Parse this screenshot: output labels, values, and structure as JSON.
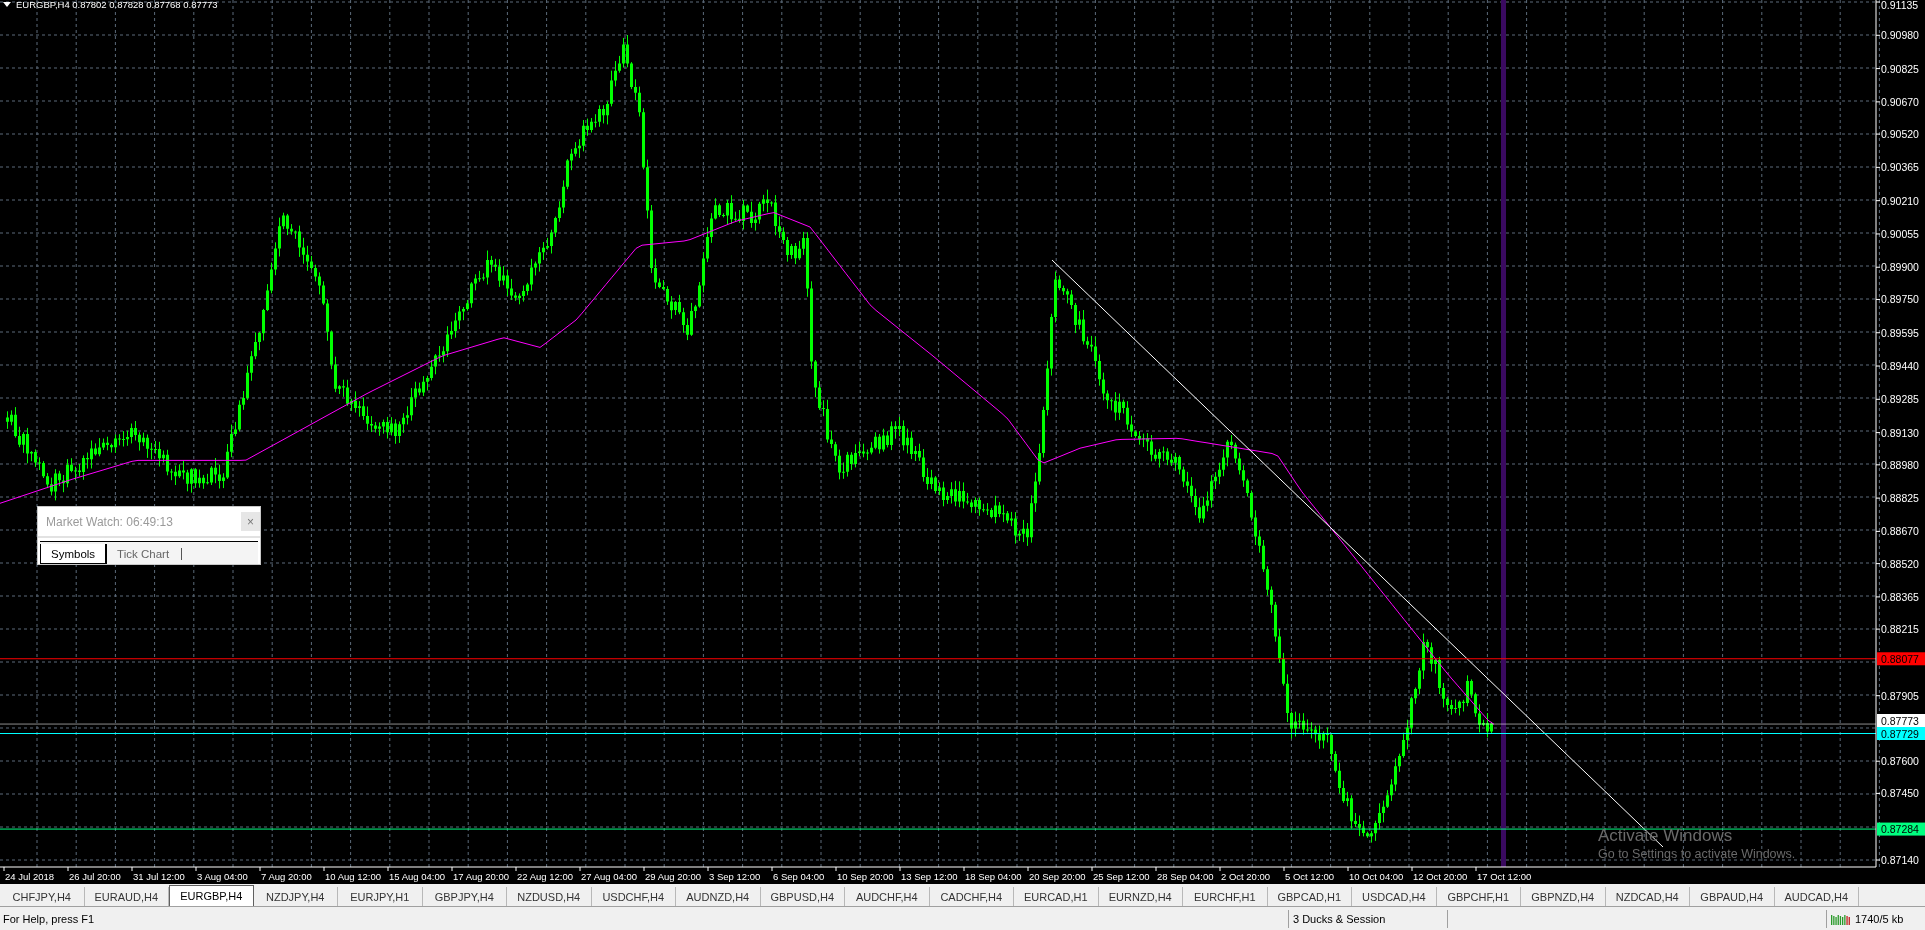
{
  "chart": {
    "title": "EURGBP,H4  0.87802 0.87828 0.87768 0.87773",
    "price_axis": [
      "0.91135",
      "0.90980",
      "0.90825",
      "0.90670",
      "0.90520",
      "0.90365",
      "0.90210",
      "0.90055",
      "0.89900",
      "0.89750",
      "0.89595",
      "0.89440",
      "0.89285",
      "0.89130",
      "0.88980",
      "0.88825",
      "0.88670",
      "0.88520",
      "0.88365",
      "0.88215",
      "0.87905",
      "0.87600",
      "0.87450",
      "0.87140"
    ],
    "levels": [
      {
        "label": "0.88077",
        "color": "#ff0000"
      },
      {
        "label": "0.87773",
        "color": "#ffffff"
      },
      {
        "label": "0.87729",
        "color": "#00ffff"
      },
      {
        "label": "0.87284",
        "color": "#00ff80"
      }
    ],
    "time_axis": [
      "24 Jul 2018",
      "26 Jul 20:00",
      "31 Jul 12:00",
      "3 Aug 04:00",
      "7 Aug 20:00",
      "10 Aug 12:00",
      "15 Aug 04:00",
      "17 Aug 20:00",
      "22 Aug 12:00",
      "27 Aug 04:00",
      "29 Aug 20:00",
      "3 Sep 12:00",
      "6 Sep 04:00",
      "10 Sep 20:00",
      "13 Sep 12:00",
      "18 Sep 04:00",
      "20 Sep 20:00",
      "25 Sep 12:00",
      "28 Sep 04:00",
      "2 Oct 20:00",
      "5 Oct 12:00",
      "10 Oct 04:00",
      "12 Oct 20:00",
      "17 Oct 12:00"
    ]
  },
  "market_watch": {
    "title": "Market Watch: 06:49:13",
    "close": "×",
    "tabs": [
      {
        "label": "Symbols",
        "selected": true
      },
      {
        "label": "Tick Chart",
        "selected": false
      }
    ]
  },
  "os_notice": {
    "title": "Activate Windows",
    "subtitle": "Go to Settings to activate Windows."
  },
  "chart_tabs": [
    {
      "label": "CHFJPY,H4",
      "selected": false
    },
    {
      "label": "EURAUD,H4",
      "selected": false
    },
    {
      "label": "EURGBP,H4",
      "selected": true
    },
    {
      "label": "NZDJPY,H4",
      "selected": false
    },
    {
      "label": "EURJPY,H1",
      "selected": false
    },
    {
      "label": "GBPJPY,H4",
      "selected": false
    },
    {
      "label": "NZDUSD,H4",
      "selected": false
    },
    {
      "label": "USDCHF,H4",
      "selected": false
    },
    {
      "label": "AUDNZD,H4",
      "selected": false
    },
    {
      "label": "GBPUSD,H4",
      "selected": false
    },
    {
      "label": "AUDCHF,H4",
      "selected": false
    },
    {
      "label": "CADCHF,H4",
      "selected": false
    },
    {
      "label": "EURCAD,H1",
      "selected": false
    },
    {
      "label": "EURNZD,H4",
      "selected": false
    },
    {
      "label": "EURCHF,H1",
      "selected": false
    },
    {
      "label": "GBPCAD,H1",
      "selected": false
    },
    {
      "label": "USDCAD,H4",
      "selected": false
    },
    {
      "label": "GBPCHF,H1",
      "selected": false
    },
    {
      "label": "GBPNZD,H4",
      "selected": false
    },
    {
      "label": "NZDCAD,H4",
      "selected": false
    },
    {
      "label": "GBPAUD,H4",
      "selected": false
    },
    {
      "label": "AUDCAD,H4",
      "selected": false
    }
  ],
  "status_bar": {
    "help": "For Help, press F1",
    "profile": "3 Ducks & Session",
    "traffic": "1740/5 kb"
  }
}
